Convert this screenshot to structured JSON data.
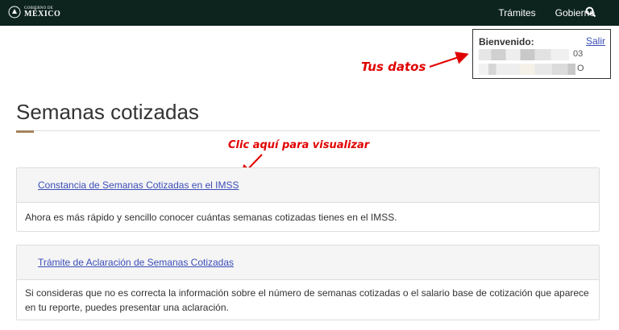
{
  "navbar": {
    "logo_line1": "GOBIERNO DE",
    "logo_line2": "MÉXICO",
    "links": [
      "Trámites",
      "Gobierno"
    ],
    "search_icon": "search-icon",
    "background": "#0c231e"
  },
  "welcome": {
    "title": "Bienvenido:",
    "logout": "Salir",
    "line1_suffix": "03",
    "line2_suffix": "O"
  },
  "annotations": {
    "your_data": "Tus datos",
    "click_here": "Clic aquí para visualizar",
    "color": "#e10000"
  },
  "page": {
    "title": "Semanas cotizadas",
    "accent_color": "#a5835c"
  },
  "panels": [
    {
      "link": "Constancia de Semanas Cotizadas en el IMSS",
      "body": "Ahora es más rápido y sencillo conocer cuántas semanas cotizadas tienes en el IMSS."
    },
    {
      "link": "Trámite de Aclaración de Semanas Cotizadas",
      "body": "Si consideras que no es correcta la información sobre el número de semanas cotizadas o el salario base de cotización que aparece en tu reporte, puedes presentar una aclaración."
    }
  ],
  "link_color": "#3b4db8"
}
